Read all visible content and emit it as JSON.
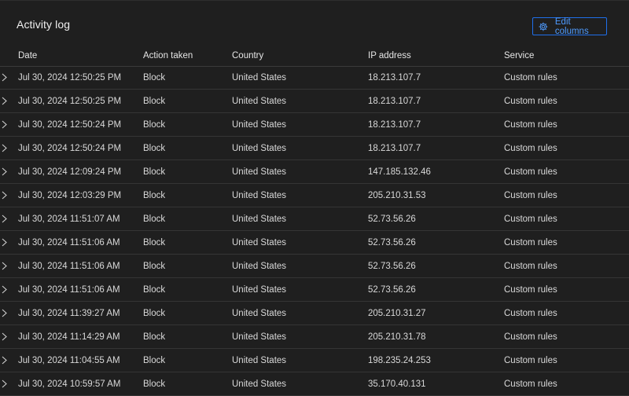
{
  "panel": {
    "title": "Activity log",
    "edit_columns_label": "Edit columns",
    "edit_columns_icon": "gear-icon",
    "accent_color": "#1f6feb"
  },
  "columns": [
    "Date",
    "Action taken",
    "Country",
    "IP address",
    "Service"
  ],
  "rows": [
    {
      "date": "Jul 30, 2024 12:50:25 PM",
      "action": "Block",
      "country": "United States",
      "ip": "18.213.107.7",
      "service": "Custom rules"
    },
    {
      "date": "Jul 30, 2024 12:50:25 PM",
      "action": "Block",
      "country": "United States",
      "ip": "18.213.107.7",
      "service": "Custom rules"
    },
    {
      "date": "Jul 30, 2024 12:50:24 PM",
      "action": "Block",
      "country": "United States",
      "ip": "18.213.107.7",
      "service": "Custom rules"
    },
    {
      "date": "Jul 30, 2024 12:50:24 PM",
      "action": "Block",
      "country": "United States",
      "ip": "18.213.107.7",
      "service": "Custom rules"
    },
    {
      "date": "Jul 30, 2024 12:09:24 PM",
      "action": "Block",
      "country": "United States",
      "ip": "147.185.132.46",
      "service": "Custom rules"
    },
    {
      "date": "Jul 30, 2024 12:03:29 PM",
      "action": "Block",
      "country": "United States",
      "ip": "205.210.31.53",
      "service": "Custom rules"
    },
    {
      "date": "Jul 30, 2024 11:51:07 AM",
      "action": "Block",
      "country": "United States",
      "ip": "52.73.56.26",
      "service": "Custom rules"
    },
    {
      "date": "Jul 30, 2024 11:51:06 AM",
      "action": "Block",
      "country": "United States",
      "ip": "52.73.56.26",
      "service": "Custom rules"
    },
    {
      "date": "Jul 30, 2024 11:51:06 AM",
      "action": "Block",
      "country": "United States",
      "ip": "52.73.56.26",
      "service": "Custom rules"
    },
    {
      "date": "Jul 30, 2024 11:51:06 AM",
      "action": "Block",
      "country": "United States",
      "ip": "52.73.56.26",
      "service": "Custom rules"
    },
    {
      "date": "Jul 30, 2024 11:39:27 AM",
      "action": "Block",
      "country": "United States",
      "ip": "205.210.31.27",
      "service": "Custom rules"
    },
    {
      "date": "Jul 30, 2024 11:14:29 AM",
      "action": "Block",
      "country": "United States",
      "ip": "205.210.31.78",
      "service": "Custom rules"
    },
    {
      "date": "Jul 30, 2024 11:04:55 AM",
      "action": "Block",
      "country": "United States",
      "ip": "198.235.24.253",
      "service": "Custom rules"
    },
    {
      "date": "Jul 30, 2024 10:59:57 AM",
      "action": "Block",
      "country": "United States",
      "ip": "35.170.40.131",
      "service": "Custom rules"
    }
  ],
  "row_expand_icon": "chevron-right-icon"
}
